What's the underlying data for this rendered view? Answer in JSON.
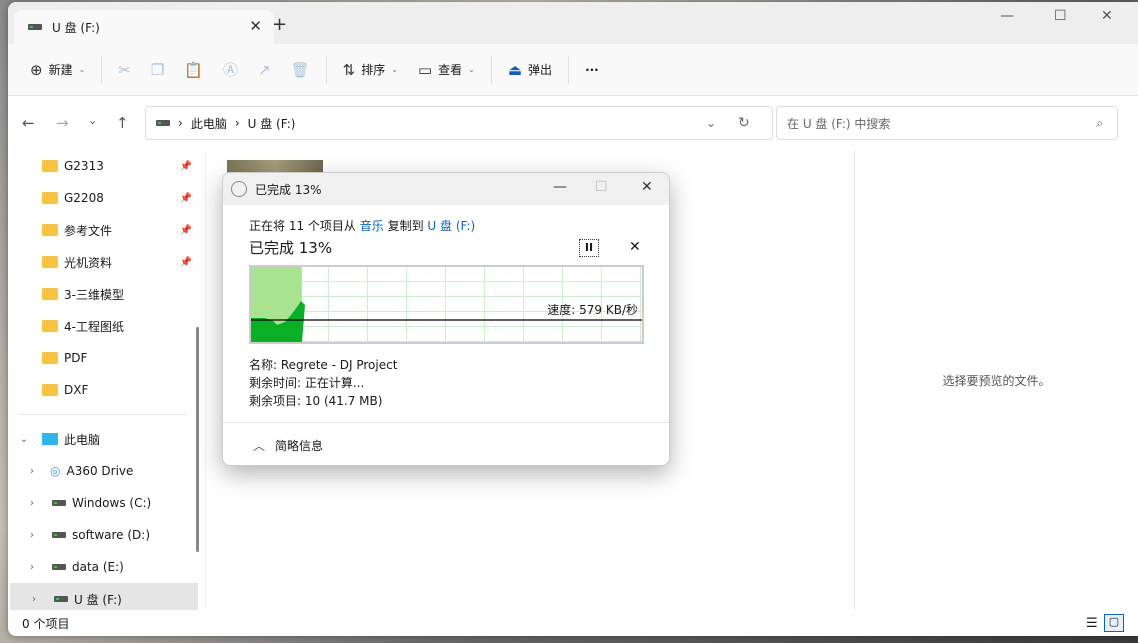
{
  "tab": {
    "title": "U 盘 (F:)"
  },
  "toolbar": {
    "new": "新建",
    "sort": "排序",
    "view": "查看",
    "eject": "弹出",
    "more": "···"
  },
  "address": {
    "crumbs": [
      "此电脑",
      "U 盘 (F:)"
    ],
    "search_placeholder": "在 U 盘 (F:) 中搜索"
  },
  "sidebar": {
    "pinned": [
      "G2313",
      "G2208",
      "参考文件",
      "光机资料",
      "3-三维模型",
      "4-工程图纸",
      "PDF",
      "DXF"
    ],
    "pc": "此电脑",
    "drives": [
      "A360 Drive",
      "Windows (C:)",
      "software (D:)",
      "data (E:)",
      "U 盘 (F:)"
    ]
  },
  "preview": "选择要预览的文件。",
  "status": "0 个项目",
  "dialog": {
    "title": "已完成 13%",
    "pre": "正在将 11 个项目从",
    "src": "音乐",
    "mid": "复制到",
    "dst": "U 盘 (F:)",
    "percent": "已完成 13%",
    "progress": 0.13,
    "speed": "速度: 579 KB/秒",
    "name": "名称: Regrete - DJ Project",
    "time": "剩余时间: 正在计算...",
    "items": "剩余项目: 10 (41.7 MB)",
    "less": "简略信息",
    "colors": {
      "progress": "#a8e38f",
      "rate": "#0aaf28"
    }
  }
}
